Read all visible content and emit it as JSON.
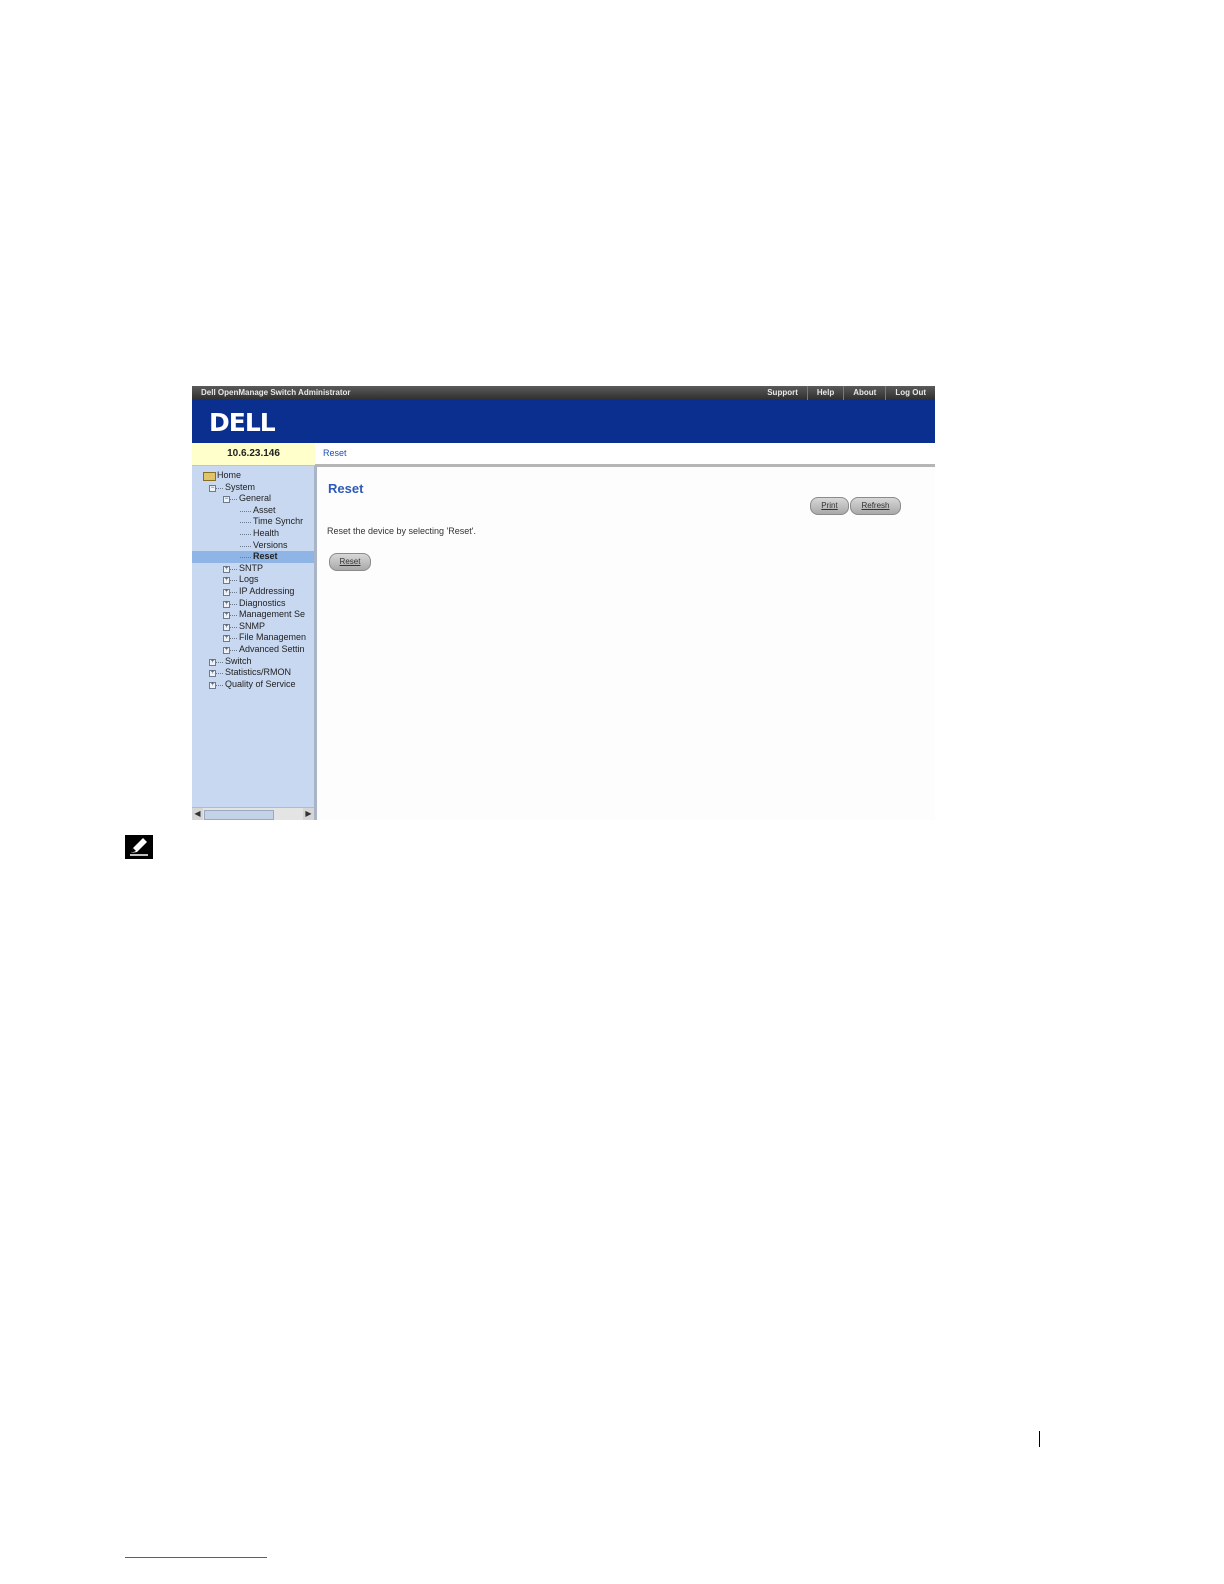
{
  "app": {
    "title": "Dell OpenManage Switch Administrator",
    "top_links": [
      "Support",
      "Help",
      "About",
      "Log Out"
    ],
    "logo": "DELL"
  },
  "device": {
    "ip": "10.6.23.146"
  },
  "breadcrumb": "Reset",
  "tree": {
    "home": "Home",
    "items": [
      {
        "label": "System",
        "level": 1,
        "expander": "minus"
      },
      {
        "label": "General",
        "level": 2,
        "expander": "minus"
      },
      {
        "label": "Asset",
        "level": 3,
        "expander": "none"
      },
      {
        "label": "Time Synchr",
        "level": 3,
        "expander": "none"
      },
      {
        "label": "Health",
        "level": 3,
        "expander": "none"
      },
      {
        "label": "Versions",
        "level": 3,
        "expander": "none"
      },
      {
        "label": "Reset",
        "level": 3,
        "expander": "none",
        "selected": true
      },
      {
        "label": "SNTP",
        "level": 2,
        "expander": "plus"
      },
      {
        "label": "Logs",
        "level": 2,
        "expander": "plus"
      },
      {
        "label": "IP Addressing",
        "level": 2,
        "expander": "plus"
      },
      {
        "label": "Diagnostics",
        "level": 2,
        "expander": "plus"
      },
      {
        "label": "Management Se",
        "level": 2,
        "expander": "plus"
      },
      {
        "label": "SNMP",
        "level": 2,
        "expander": "plus"
      },
      {
        "label": "File Managemen",
        "level": 2,
        "expander": "plus"
      },
      {
        "label": "Advanced Settin",
        "level": 2,
        "expander": "plus"
      },
      {
        "label": "Switch",
        "level": 1,
        "expander": "plus"
      },
      {
        "label": "Statistics/RMON",
        "level": 1,
        "expander": "plus"
      },
      {
        "label": "Quality of Service",
        "level": 1,
        "expander": "plus"
      }
    ]
  },
  "page": {
    "title": "Reset",
    "print_label": "Print",
    "refresh_label": "Refresh",
    "description": "Reset the device by selecting 'Reset'.",
    "reset_label": "Reset"
  },
  "colors": {
    "banner": "#0b2f8f",
    "sidebar": "#c7d8f0",
    "selected": "#8fb5e6",
    "ip_box": "#ffffcc",
    "title": "#2d5bb8"
  }
}
